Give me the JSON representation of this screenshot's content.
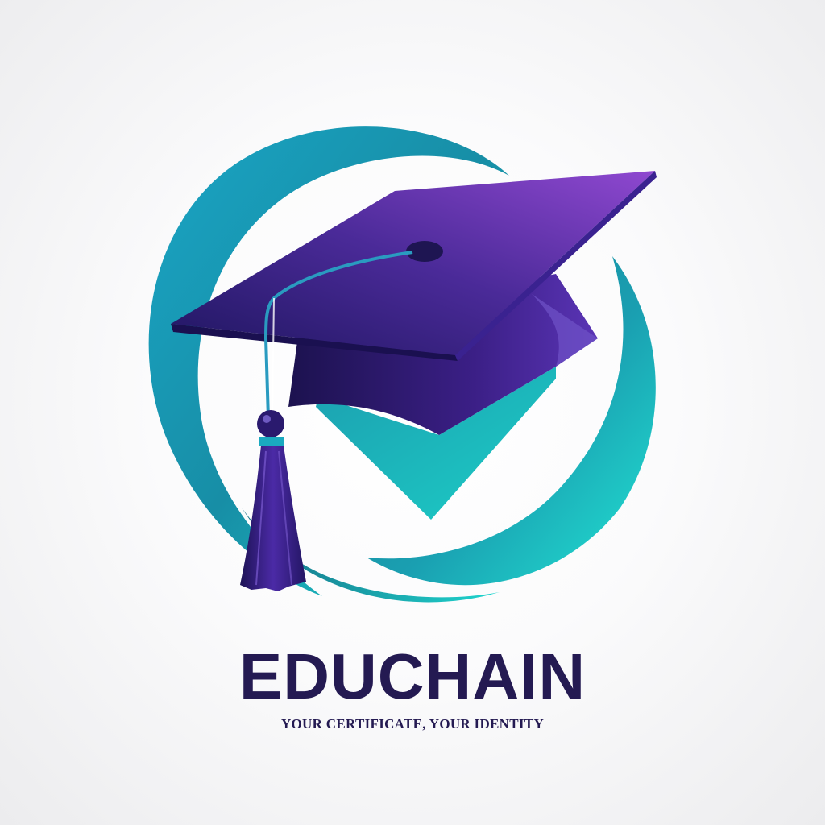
{
  "brand": {
    "name": "EDUCHAIN",
    "tagline": "YOUR CERTIFICATE, YOUR IDENTITY"
  },
  "colors": {
    "primary_text": "#241a52",
    "teal": "#19b5c7",
    "teal_light": "#1ee0d4",
    "purple_dark": "#2a1a6e",
    "purple_light": "#8a46c8"
  },
  "icons": [
    "graduation-cap-icon",
    "swoosh-ring-icon",
    "tassel-icon",
    "checkmark-shield-icon"
  ]
}
